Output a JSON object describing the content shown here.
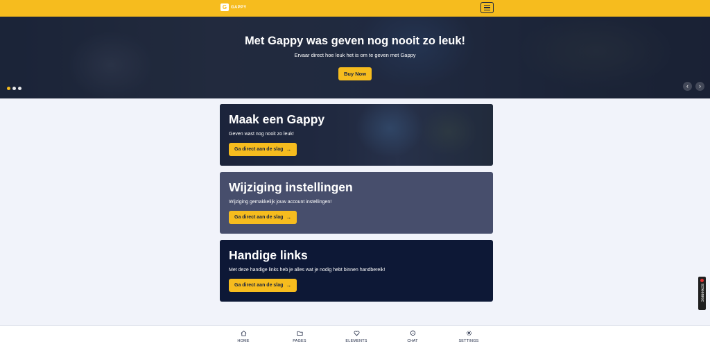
{
  "header": {
    "logo_mark": "G",
    "logo_text": "GAPPY",
    "menu_icon": "hamburger-icon",
    "accent_color": "#f6bc1e"
  },
  "hero": {
    "title": "Met Gappy was geven nog nooit zo leuk!",
    "subtitle": "Ervaar direct hoe leuk het is om te geven met Gappy",
    "button_label": "Buy Now",
    "slides": 3,
    "active_slide": 1,
    "prev_icon": "chevron-left-icon",
    "next_icon": "chevron-right-icon"
  },
  "cards": [
    {
      "title": "Maak een Gappy",
      "subtitle": "Geven wast nog nooit zo leuk!",
      "button_label": "Ga direct aan de slag",
      "button_icon": "arrow-right-icon"
    },
    {
      "title": "Wijziging instellingen",
      "subtitle": "Wijziging gemakkelijk jouw account instellingen!",
      "button_label": "Ga direct aan de slag",
      "button_icon": "arrow-right-icon"
    },
    {
      "title": "Handige links",
      "subtitle": "Met deze handige links heb je alles wat je nodig hebt binnen handbereik!",
      "button_label": "Ga direct aan de slag",
      "button_icon": "arrow-right-icon"
    }
  ],
  "screencast_badge": "screenrec",
  "bottom_nav": [
    {
      "label": "HOME",
      "icon": "home-icon"
    },
    {
      "label": "PAGES",
      "icon": "folder-icon"
    },
    {
      "label": "ELEMENTS",
      "icon": "heart-icon"
    },
    {
      "label": "CHAT",
      "icon": "chat-icon"
    },
    {
      "label": "SETTINGS",
      "icon": "gear-icon"
    }
  ]
}
